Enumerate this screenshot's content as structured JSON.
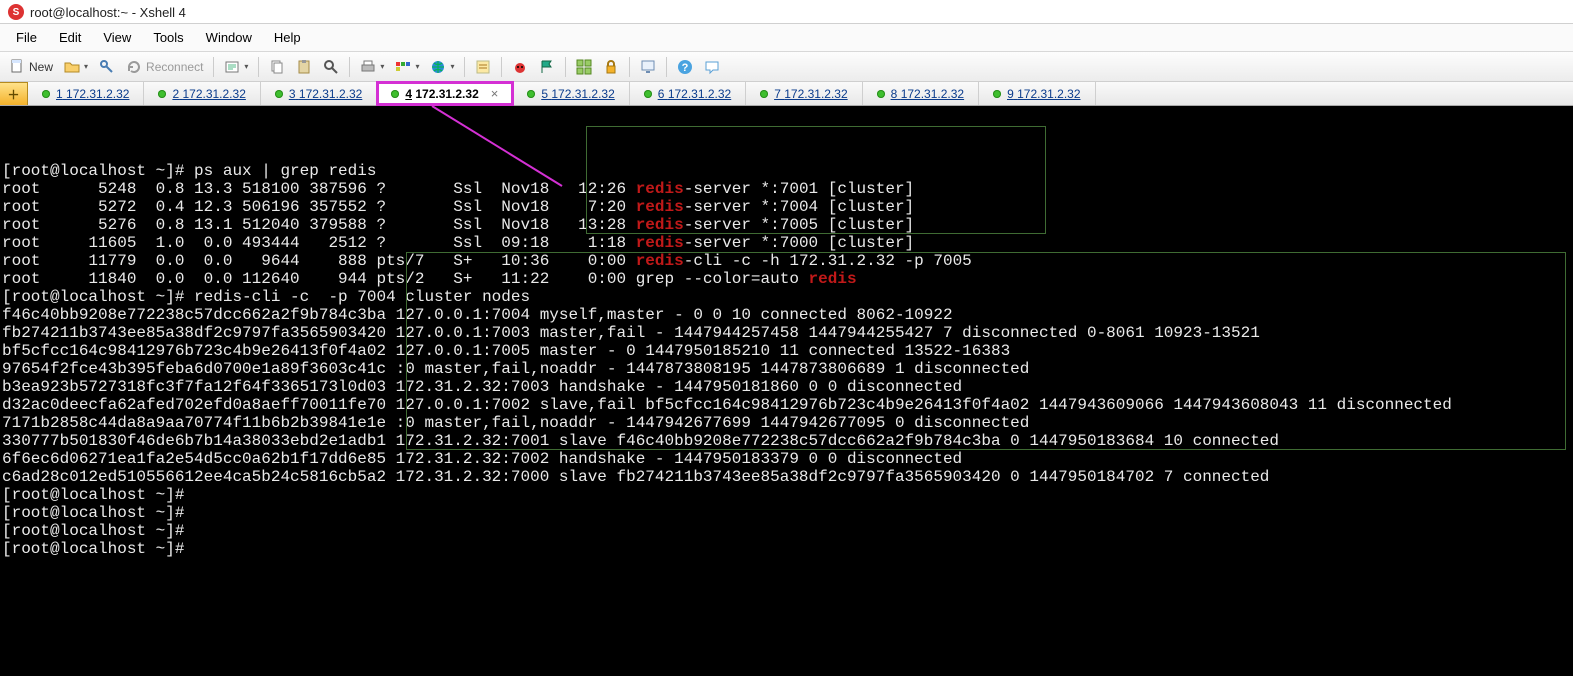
{
  "window_title": "root@localhost:~ - Xshell 4",
  "menus": [
    "File",
    "Edit",
    "View",
    "Tools",
    "Window",
    "Help"
  ],
  "toolbar": {
    "new_label": "New",
    "reconnect_label": "Reconnect"
  },
  "tabs": [
    {
      "num": "1",
      "ip": "172.31.2.32",
      "active": false
    },
    {
      "num": "2",
      "ip": "172.31.2.32",
      "active": false
    },
    {
      "num": "3",
      "ip": "172.31.2.32",
      "active": false
    },
    {
      "num": "4",
      "ip": "172.31.2.32",
      "active": true
    },
    {
      "num": "5",
      "ip": "172.31.2.32",
      "active": false
    },
    {
      "num": "6",
      "ip": "172.31.2.32",
      "active": false
    },
    {
      "num": "7",
      "ip": "172.31.2.32",
      "active": false
    },
    {
      "num": "8",
      "ip": "172.31.2.32",
      "active": false
    },
    {
      "num": "9",
      "ip": "172.31.2.32",
      "active": false
    }
  ],
  "terminal": {
    "prompt": "[root@localhost ~]#",
    "cmd1": "ps aux | grep redis",
    "ps": [
      {
        "user": "root",
        "pid": "5248",
        "cpu": "0.8",
        "mem": "13.3",
        "vsz": "518100",
        "rss": "387596",
        "tty": "?",
        "stat": "Ssl",
        "start": "Nov18",
        "time": "12:26",
        "cmd_pre": "",
        "highlight": "redis",
        "cmd_post": "-server *:7001 [cluster]"
      },
      {
        "user": "root",
        "pid": "5272",
        "cpu": "0.4",
        "mem": "12.3",
        "vsz": "506196",
        "rss": "357552",
        "tty": "?",
        "stat": "Ssl",
        "start": "Nov18",
        "time": "7:20",
        "cmd_pre": "",
        "highlight": "redis",
        "cmd_post": "-server *:7004 [cluster]"
      },
      {
        "user": "root",
        "pid": "5276",
        "cpu": "0.8",
        "mem": "13.1",
        "vsz": "512040",
        "rss": "379588",
        "tty": "?",
        "stat": "Ssl",
        "start": "Nov18",
        "time": "13:28",
        "cmd_pre": "",
        "highlight": "redis",
        "cmd_post": "-server *:7005 [cluster]"
      },
      {
        "user": "root",
        "pid": "11605",
        "cpu": "1.0",
        "mem": "0.0",
        "vsz": "493444",
        "rss": "2512",
        "tty": "?",
        "stat": "Ssl",
        "start": "09:18",
        "time": "1:18",
        "cmd_pre": "",
        "highlight": "redis",
        "cmd_post": "-server *:7000 [cluster]"
      },
      {
        "user": "root",
        "pid": "11779",
        "cpu": "0.0",
        "mem": "0.0",
        "vsz": "9644",
        "rss": "888",
        "tty": "pts/7",
        "stat": "S+",
        "start": "10:36",
        "time": "0:00",
        "cmd_pre": "",
        "highlight": "redis",
        "cmd_post": "-cli -c -h 172.31.2.32 -p 7005"
      },
      {
        "user": "root",
        "pid": "11840",
        "cpu": "0.0",
        "mem": "0.0",
        "vsz": "112640",
        "rss": "944",
        "tty": "pts/2",
        "stat": "S+",
        "start": "11:22",
        "time": "0:00",
        "cmd_pre": "grep --color=auto ",
        "highlight": "redis",
        "cmd_post": ""
      }
    ],
    "cmd2": "redis-cli -c  -p 7004 cluster nodes",
    "nodes": [
      {
        "id": "f46c40bb9208e772238c57dcc662a2f9b784c3ba",
        "rest": "127.0.0.1:7004 myself,master - 0 0 10 connected 8062-10922"
      },
      {
        "id": "fb274211b3743ee85a38df2c9797fa3565903420",
        "rest": "127.0.0.1:7003 master,fail - 1447944257458 1447944255427 7 disconnected 0-8061 10923-13521"
      },
      {
        "id": "bf5cfcc164c98412976b723c4b9e26413f0f4a02",
        "rest": "127.0.0.1:7005 master - 0 1447950185210 11 connected 13522-16383"
      },
      {
        "id": "97654f2fce43b395feba6d0700e1a89f3603c41c",
        "rest": ":0 master,fail,noaddr - 1447873808195 1447873806689 1 disconnected"
      },
      {
        "id": "b3ea923b5727318fc3f7fa12f64f3365173l0d03",
        "rest": "172.31.2.32:7003 handshake - 1447950181860 0 0 disconnected"
      },
      {
        "id": "d32ac0deecfa62afed702efd0a8aeff70011fe70",
        "rest": "127.0.0.1:7002 slave,fail bf5cfcc164c98412976b723c4b9e26413f0f4a02 1447943609066 1447943608043 11 disconnected"
      },
      {
        "id": "7171b2858c44da8a9aa70774f11b6b2b39841e1e",
        "rest": ":0 master,fail,noaddr - 1447942677699 1447942677095 0 disconnected"
      },
      {
        "id": "330777b501830f46de6b7b14a38033ebd2e1adb1",
        "rest": "172.31.2.32:7001 slave f46c40bb9208e772238c57dcc662a2f9b784c3ba 0 1447950183684 10 connected"
      },
      {
        "id": "6f6ec6d06271ea1fa2e54d5cc0a62b1f17dd6e85",
        "rest": "172.31.2.32:7002 handshake - 1447950183379 0 0 disconnected"
      },
      {
        "id": "c6ad28c012ed510556612ee4ca5b24c5816cb5a2",
        "rest": "172.31.2.32:7000 slave fb274211b3743ee85a38df2c9797fa3565903420 0 1447950184702 7 connected"
      }
    ]
  }
}
